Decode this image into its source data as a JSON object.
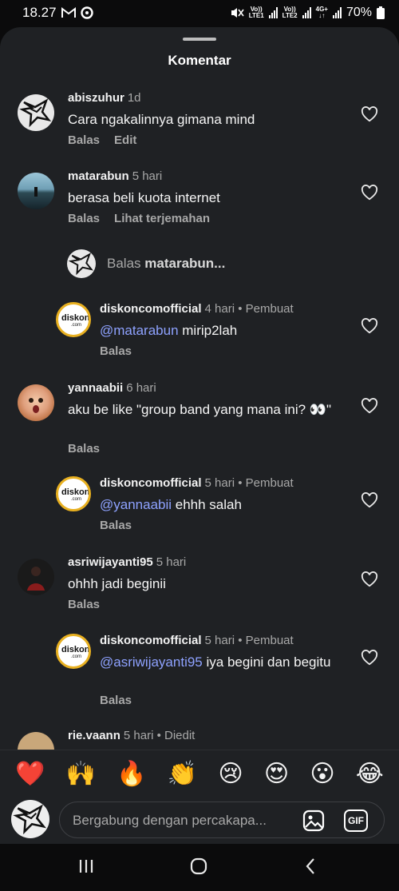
{
  "status_bar": {
    "time": "18.27",
    "battery": "70%",
    "lte1": "LTE1",
    "lte2": "LTE2",
    "volte": "Vo))",
    "net": "4G+"
  },
  "sheet": {
    "title": "Komentar"
  },
  "comments": [
    {
      "user": "abiszuhur",
      "time": "1d",
      "text": "Cara ngakalinnya gimana mind",
      "actions": [
        "Balas",
        "Edit"
      ]
    },
    {
      "user": "matarabun",
      "time": "5 hari",
      "text": "berasa beli kuota internet",
      "actions": [
        "Balas",
        "Lihat terjemahan"
      ]
    },
    {
      "user": "diskoncomofficial",
      "time": "4 hari",
      "badge": " • Pembuat",
      "mention": "@matarabun",
      "text": " mirip2lah",
      "actions": [
        "Balas"
      ]
    },
    {
      "user": "yannaabii",
      "time": "6 hari",
      "text": "aku be like \"group band yang mana ini? 👀\"",
      "actions": [
        "Balas"
      ]
    },
    {
      "user": "diskoncomofficial",
      "time": "5 hari",
      "badge": " • Pembuat",
      "mention": "@yannaabii",
      "text": " ehhh salah",
      "actions": [
        "Balas"
      ]
    },
    {
      "user": "asriwijayanti95",
      "time": "5 hari",
      "text": "ohhh jadi beginii",
      "actions": [
        "Balas"
      ]
    },
    {
      "user": "diskoncomofficial",
      "time": "5 hari",
      "badge": " • Pembuat",
      "mention": "@asriwijayanti95",
      "text": " iya begini dan begitu",
      "actions": [
        "Balas"
      ]
    },
    {
      "user": "rie.vaann",
      "time": "5 hari",
      "badge": " • Diedit"
    }
  ],
  "reply_prompt": {
    "prefix": "Balas",
    "target": "matarabun..."
  },
  "logo_text": {
    "name": "diskon",
    "sub": ".com"
  },
  "emoji_bar": [
    "❤️",
    "🙌",
    "🔥",
    "👏",
    "😢",
    "😍",
    "😮",
    "😂"
  ],
  "composer": {
    "placeholder": "Bergabung dengan percakapa...",
    "gif_label": "GIF"
  },
  "icons": {
    "heart": "heart-icon",
    "image": "image-icon",
    "gif": "gif-icon",
    "recents": "recent-apps-icon",
    "home": "home-icon",
    "back": "back-icon"
  }
}
